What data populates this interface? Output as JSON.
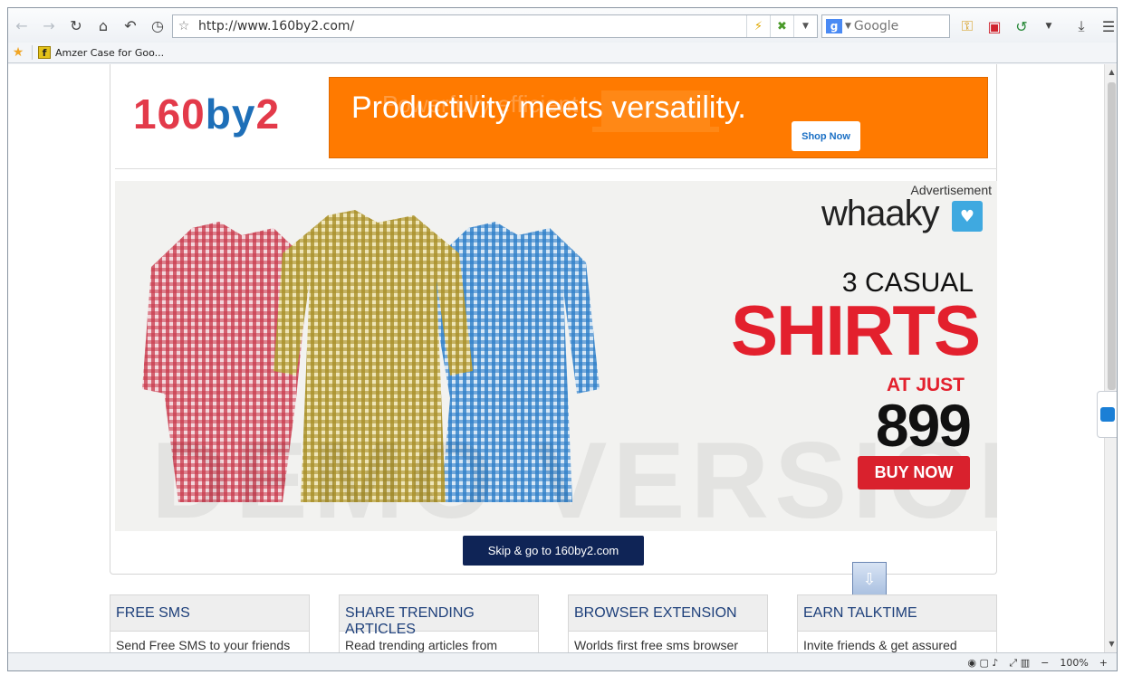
{
  "browser": {
    "nav_buttons": [
      "back-icon",
      "forward-icon",
      "reload-icon",
      "home-icon",
      "undo-icon",
      "history-icon"
    ],
    "url": "http://www.160by2.com/",
    "search_placeholder": "Google",
    "search_engine_letter": "g",
    "bookmarks": [
      {
        "label": "Amzer Case for Goo..."
      }
    ],
    "zoom": "100%"
  },
  "page": {
    "logo": {
      "part1": "160",
      "part2": "by",
      "part3": "2"
    },
    "top_ad": {
      "faded_text": "Powerfully efficient",
      "headline": "Productivity meets versatility.",
      "cta": "Shop Now"
    },
    "banner": {
      "ad_label": "Advertisement",
      "brand": "whaaky",
      "line1": "3 CASUAL",
      "line2": "SHIRTS",
      "line3": "AT JUST",
      "price": "899",
      "cta": "BUY NOW",
      "watermark": "DEMO VERSION",
      "shirt_colors": [
        "#c8384a",
        "#b8a238",
        "#2e7fc8"
      ]
    },
    "skip_button": "Skip & go to 160by2.com",
    "features": [
      {
        "title": "FREE SMS",
        "desc": "Send Free SMS to your friends"
      },
      {
        "title": "SHARE TRENDING ARTICLES",
        "desc": "Read trending articles from"
      },
      {
        "title": "BROWSER EXTENSION",
        "desc": "Worlds first free sms browser"
      },
      {
        "title": "EARN TALKTIME",
        "desc": "Invite friends & get assured"
      }
    ]
  },
  "colors": {
    "brand_red": "#e33a4a",
    "brand_blue": "#1e6fb8",
    "ad_orange": "#ff7a00",
    "skip_navy": "#0f2456"
  }
}
